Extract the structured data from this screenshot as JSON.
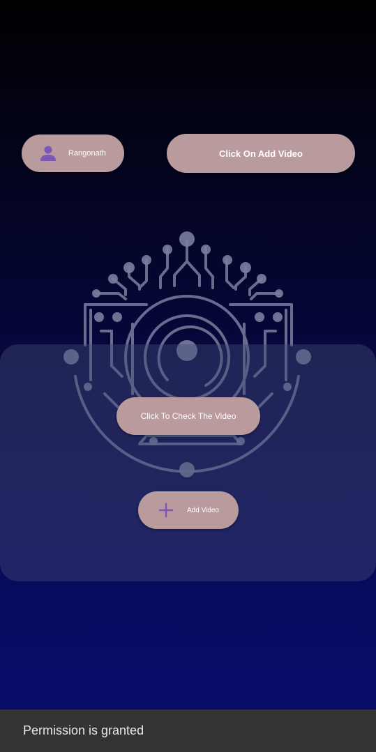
{
  "header": {
    "user_name": "Rangonath",
    "add_video_label": "Click On Add Video"
  },
  "main": {
    "check_video_label": "Click To Check The Video",
    "add_video_label": "Add Video"
  },
  "snackbar": {
    "message": "Permission is granted"
  },
  "icons": {
    "user": "person-icon",
    "add": "plus-icon",
    "logo": "camera-circuit-logo"
  },
  "colors": {
    "button": "#b99a9d",
    "icon_accent": "#7b57b8",
    "snackbar_bg": "#333333"
  }
}
